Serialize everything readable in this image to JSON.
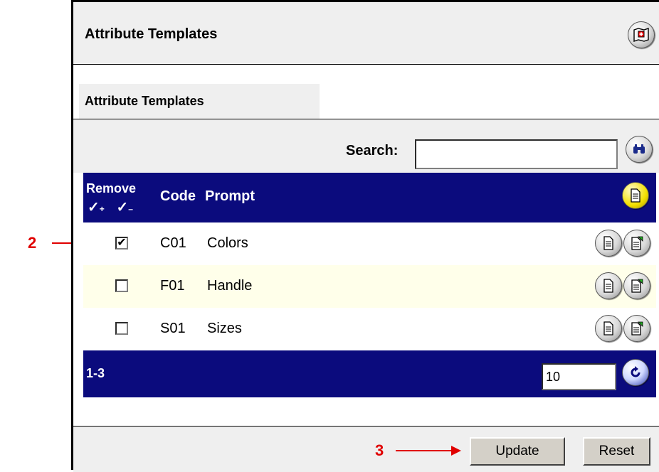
{
  "header": {
    "title": "Attribute Templates",
    "close_icon": "close-map-icon"
  },
  "tab": {
    "label": "Attribute Templates"
  },
  "search": {
    "label": "Search:",
    "value": "",
    "button_icon": "binoculars-icon"
  },
  "table": {
    "columns": {
      "remove": "Remove",
      "check_all": "✓",
      "check_all_sign": "+",
      "uncheck_all": "✓",
      "uncheck_all_sign": "–",
      "code": "Code",
      "prompt": "Prompt"
    },
    "add_icon": "new-document-icon",
    "rows": [
      {
        "checked": "✔",
        "code": "C01",
        "prompt": "Colors"
      },
      {
        "checked": "",
        "code": "F01",
        "prompt": "Handle"
      },
      {
        "checked": "",
        "code": "S01",
        "prompt": "Sizes"
      }
    ],
    "row_icons": [
      "view-document-icon",
      "edit-document-icon"
    ]
  },
  "pagination": {
    "range": "1-3",
    "page_size": "10",
    "refresh_icon": "refresh-icon"
  },
  "footer": {
    "update_label": "Update",
    "reset_label": "Reset"
  },
  "annotations": {
    "step2": "2",
    "step3": "3"
  },
  "colors": {
    "header_bar": "#0b0b7d",
    "alt_row": "#ffffea",
    "panel_gray": "#efefef",
    "annotation": "#e00000"
  }
}
